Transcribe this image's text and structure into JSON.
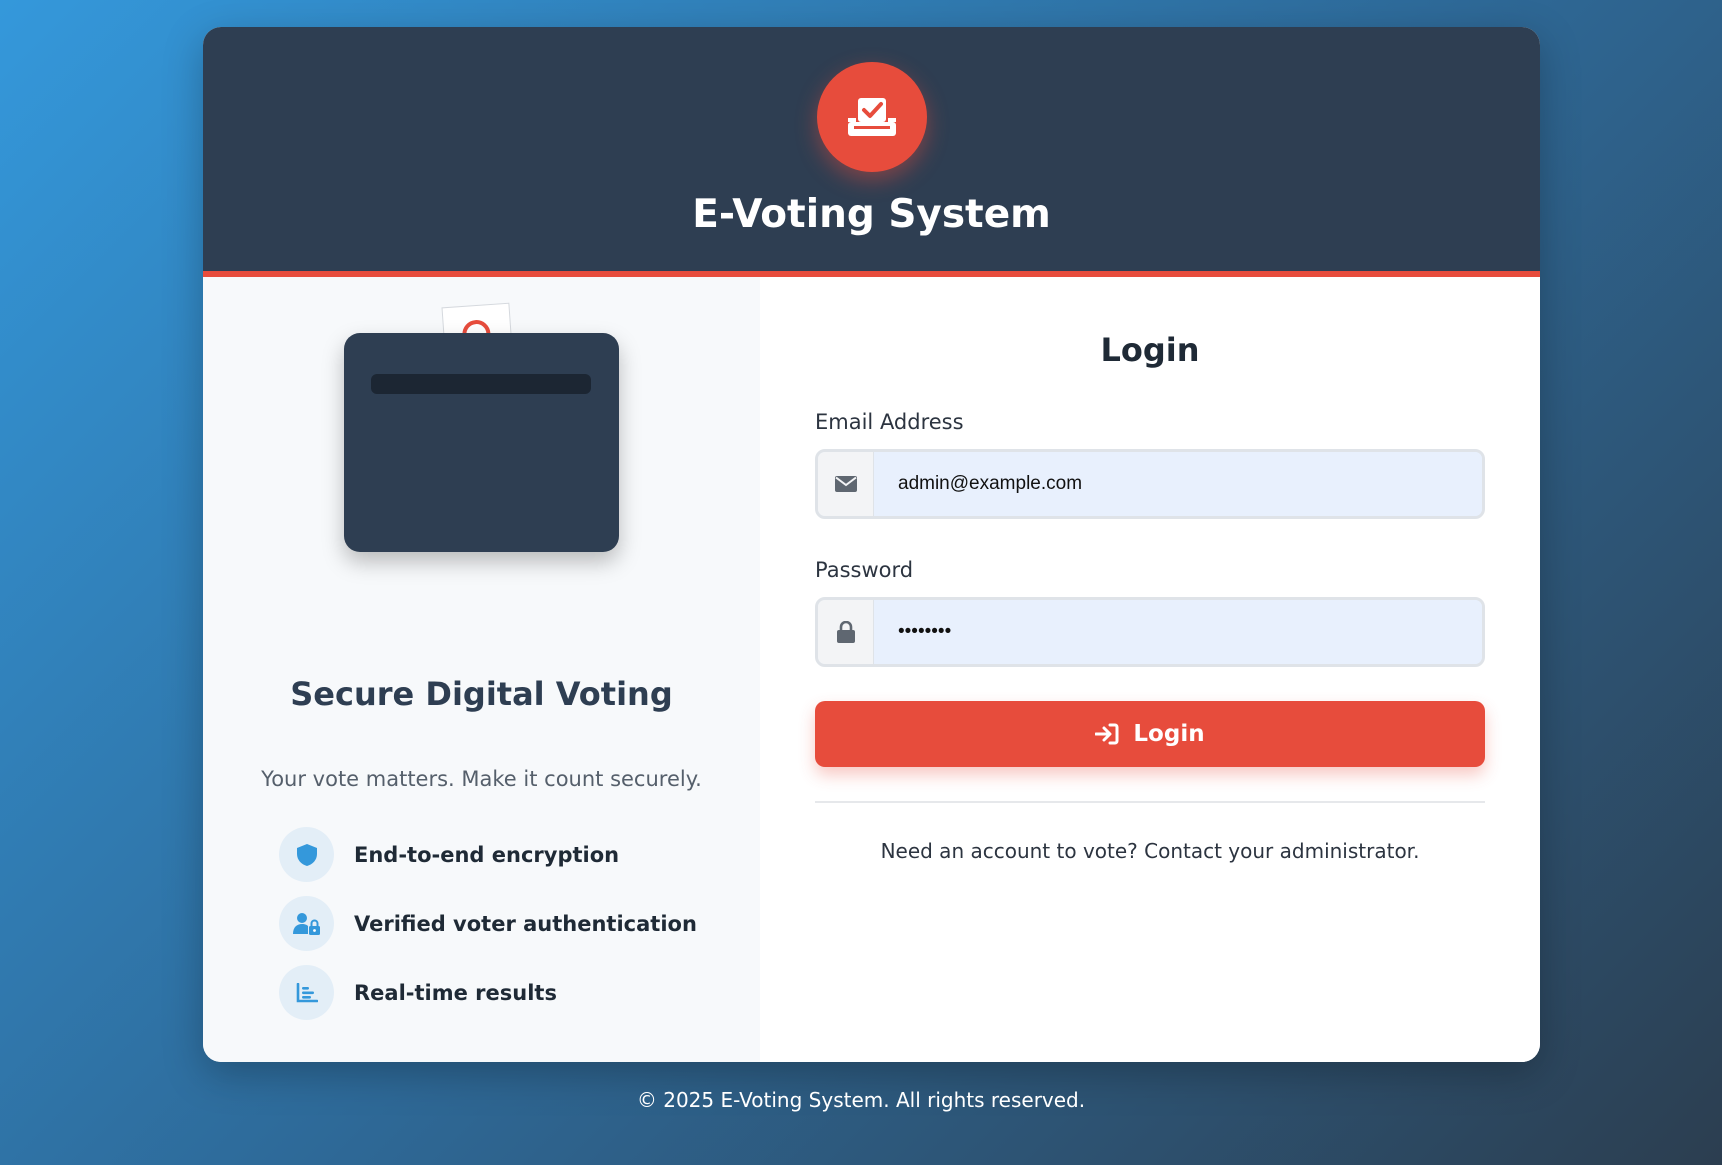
{
  "header": {
    "logo_icon": "ballot-box-check-icon",
    "title": "E-Voting System"
  },
  "left_panel": {
    "illustration": "ballot-box-illustration",
    "title": "Secure Digital Voting",
    "subtitle": "Your vote matters. Make it count securely.",
    "features": [
      {
        "icon": "shield-icon",
        "label": "End-to-end encryption"
      },
      {
        "icon": "user-lock-icon",
        "label": "Verified voter authentication"
      },
      {
        "icon": "chart-icon",
        "label": "Real-time results"
      }
    ]
  },
  "login_form": {
    "title": "Login",
    "email_label": "Email Address",
    "email_value": "admin@example.com",
    "email_icon": "envelope-icon",
    "password_label": "Password",
    "password_value": "••••••••",
    "password_icon": "lock-icon",
    "submit_label": "Login",
    "submit_icon": "sign-in-icon",
    "footer_note": "Need an account to vote? Contact your administrator."
  },
  "footer": {
    "copyright": "© 2025 E-Voting System. All rights reserved."
  },
  "colors": {
    "accent": "#e74c3c",
    "header_bg": "#2e3e52",
    "feature_icon": "#3498db"
  }
}
